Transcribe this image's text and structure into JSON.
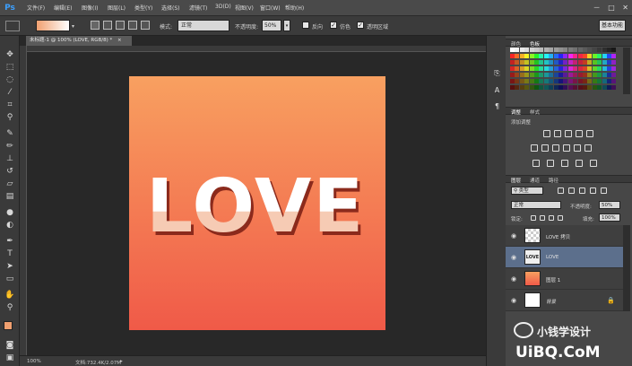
{
  "app": {
    "logo": "Ps"
  },
  "menu": [
    "文件(F)",
    "编辑(E)",
    "图像(I)",
    "图层(L)",
    "类型(Y)",
    "选择(S)",
    "滤镜(T)",
    "3D(D)",
    "视图(V)",
    "窗口(W)",
    "帮助(H)"
  ],
  "window_controls": {
    "minimize": "－",
    "restore": "□",
    "close": "✕"
  },
  "options_bar": {
    "mode_label": "模式:",
    "mode_value": "正常",
    "opacity_label": "不透明度:",
    "opacity_value": "50%",
    "reverse_label": "反向",
    "dither_label": "仿色",
    "transparency_label": "透明区域",
    "workspace": "基本功能"
  },
  "document": {
    "tab_title": "未标题-1 @ 100% (LOVE, RGB/8) *",
    "tab_close": "×",
    "artwork_text": "LOVE",
    "gradient_top": "#f8a060",
    "gradient_bottom": "#f05a48"
  },
  "status": {
    "zoom": "100%",
    "doc_info": "文档:732.4K/2.07M"
  },
  "panels": {
    "color_tabs": [
      "颜色",
      "色板"
    ],
    "adjust_tabs": [
      "调整",
      "样式"
    ],
    "adjust_title": "添加调整",
    "layers_tabs": [
      "图层",
      "通道",
      "路径"
    ],
    "kind_label": "类型",
    "blend_mode": "正常",
    "opacity_label": "不透明度:",
    "opacity_value": "50%",
    "lock_label": "锁定:",
    "fill_label": "填充:",
    "fill_value": "100%"
  },
  "layers": [
    {
      "name": "LOVE 拷贝",
      "thumb": "checker",
      "selected": false
    },
    {
      "name": "LOVE",
      "thumb": "text",
      "selected": true
    },
    {
      "name": "图层 1",
      "thumb": "gradient",
      "selected": false
    },
    {
      "name": "背景",
      "thumb": "white",
      "selected": false
    }
  ],
  "watermark": {
    "name": "小钱学设计",
    "url": "UiBQ.CoM"
  },
  "colors": {
    "foreground": "#f0a070",
    "background": "#ffffff",
    "accent": "#3ca0ff"
  }
}
